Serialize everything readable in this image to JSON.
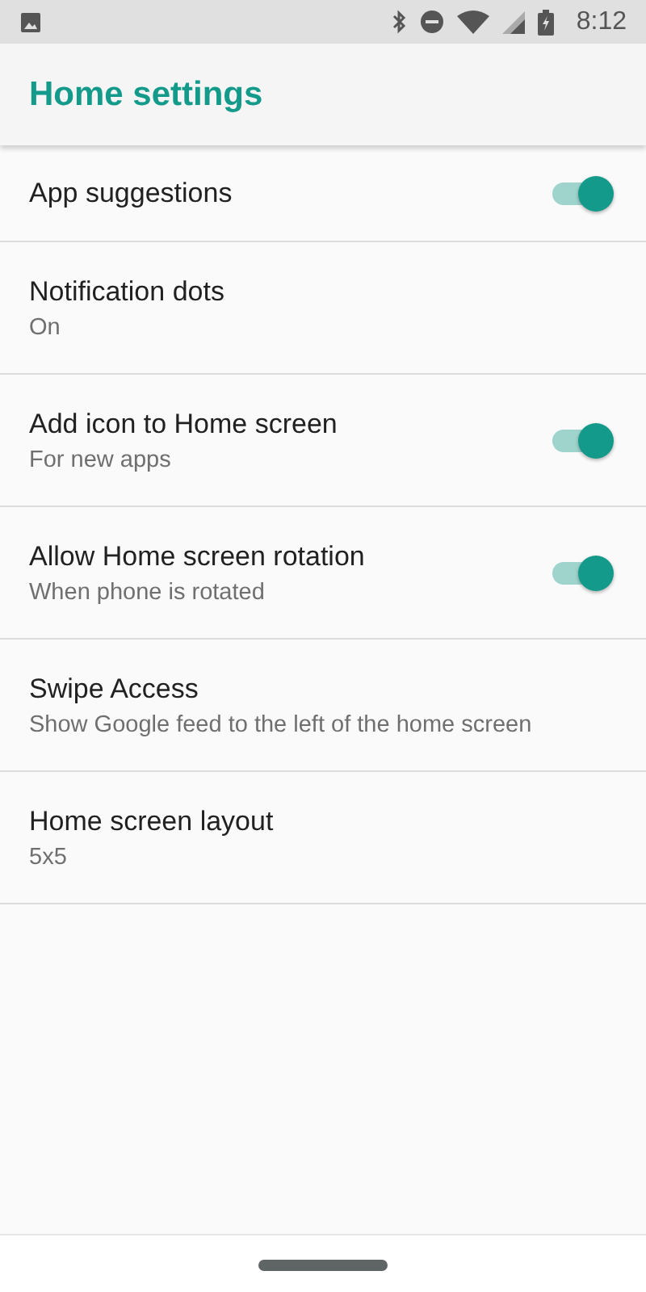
{
  "status_bar": {
    "time": "8:12"
  },
  "toolbar": {
    "title": "Home settings"
  },
  "settings": [
    {
      "kind": "toggle",
      "title": "App suggestions",
      "on": true
    },
    {
      "kind": "text",
      "title": "Notification dots",
      "summary": "On"
    },
    {
      "kind": "toggle",
      "title": "Add icon to Home screen",
      "summary": "For new apps",
      "on": true
    },
    {
      "kind": "toggle",
      "title": "Allow Home screen rotation",
      "summary": "When phone is rotated",
      "on": true
    },
    {
      "kind": "text",
      "title": "Swipe Access",
      "summary": "Show Google feed to the left of the home screen"
    },
    {
      "kind": "text",
      "title": "Home screen layout",
      "summary": "5x5"
    }
  ]
}
